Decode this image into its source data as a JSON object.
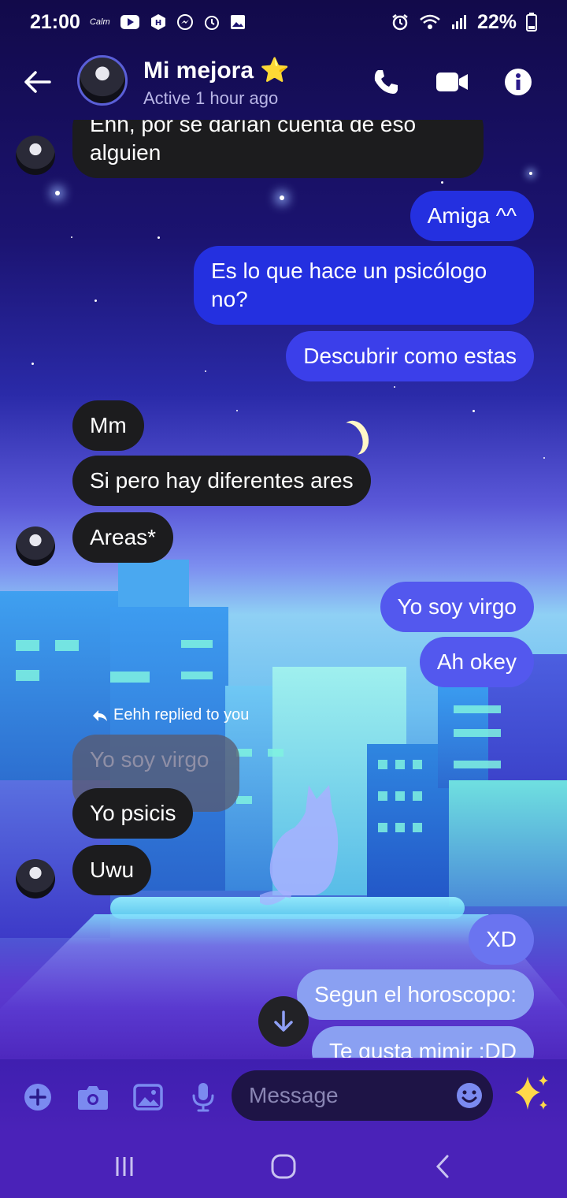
{
  "status_bar": {
    "time": "21:00",
    "calm_label": "Calm",
    "battery": "22%",
    "left_icons": [
      "youtube-icon",
      "app-icon",
      "messenger-icon",
      "alarm-icon",
      "image-icon"
    ],
    "right_icons": [
      "alarm-icon",
      "wifi-icon",
      "signal-icon",
      "battery-icon"
    ]
  },
  "header": {
    "contact_name": "Mi mejora",
    "contact_emoji": "⭐",
    "status": "Active 1 hour ago"
  },
  "messages": [
    {
      "id": "m1",
      "dir": "in",
      "text_line1": "Ehh, por se darían cuenta de eso",
      "text_line2": "alguien"
    },
    {
      "id": "m2",
      "dir": "out",
      "text": "Amiga ^^"
    },
    {
      "id": "m3",
      "dir": "out",
      "text_line1": "Es lo que hace un psicólogo",
      "text_line2": "no?"
    },
    {
      "id": "m4",
      "dir": "out",
      "text": "Descubrir como estas"
    },
    {
      "id": "m5",
      "dir": "in",
      "text": "Mm"
    },
    {
      "id": "m6",
      "dir": "in",
      "text": "Si pero hay diferentes ares"
    },
    {
      "id": "m7",
      "dir": "in",
      "text": "Areas*"
    },
    {
      "id": "m8",
      "dir": "out",
      "text": "Yo soy virgo"
    },
    {
      "id": "m9",
      "dir": "out",
      "text": "Ah okey"
    },
    {
      "id": "m10",
      "dir": "in",
      "reply_label": "Eehh replied to you",
      "quoted": "Yo soy virgo"
    },
    {
      "id": "m11",
      "dir": "in",
      "text": "Yo psicis"
    },
    {
      "id": "m12",
      "dir": "in",
      "text": "Uwu"
    },
    {
      "id": "m13",
      "dir": "out",
      "text": "XD"
    },
    {
      "id": "m14",
      "dir": "out",
      "text": "Segun el horoscopo:"
    },
    {
      "id": "m15",
      "dir": "out",
      "text": "Te gusta mimir :DD"
    }
  ],
  "composer": {
    "placeholder": "Message",
    "sparkle": "✨"
  },
  "colors": {
    "accent": "#5b6cf0",
    "incoming_bubble": "#1c1c1e",
    "outgoing_top": "#2430e0",
    "outgoing_bottom": "#8aa0f2"
  }
}
